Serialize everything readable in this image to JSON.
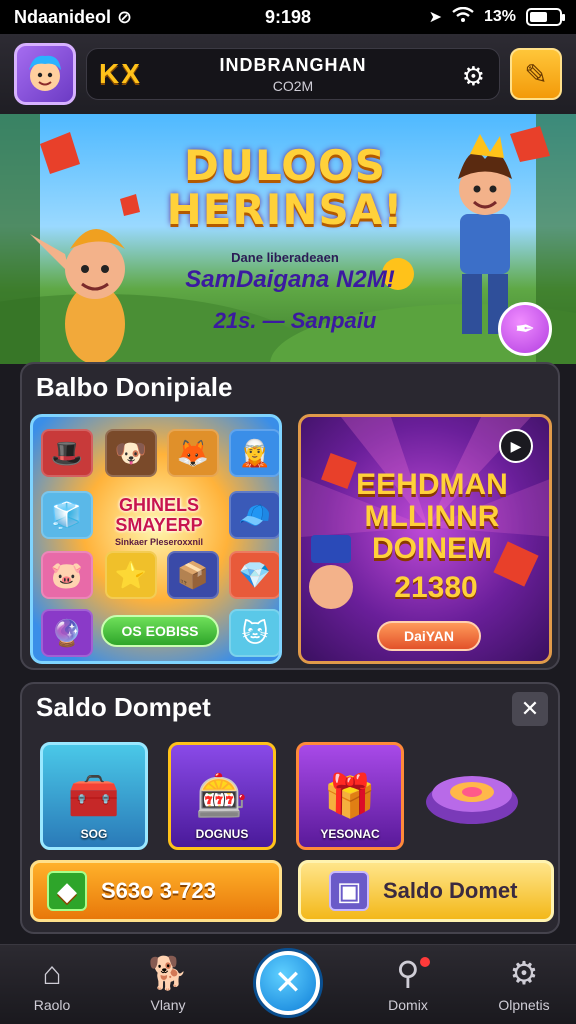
{
  "status_bar": {
    "carrier": "Ndaanideol",
    "time": "9:198",
    "battery": "13%",
    "battery_level": 0.6
  },
  "header": {
    "logo": "KX",
    "title": "INDBRANGHAN",
    "subtitle": "CO2M"
  },
  "banner": {
    "title_line1": "DULOOS",
    "title_line2": "HERINSA!",
    "small_text": "Dane liberadeaen",
    "line1": "SamDaigana N2M!",
    "line2": "21s. — Sanpaiu"
  },
  "section1": {
    "title": "Balbo Donipiale",
    "card1": {
      "label": "GHINELS SMAYERP",
      "sub_label": "Sinkaer Pleseroxxnil",
      "button": "OS EOBISS"
    },
    "card2": {
      "title": "EEHDMAN MLLINNR DOINEM",
      "value": "21380",
      "button": "DaiYAN"
    }
  },
  "section2": {
    "title": "Saldo Dompet",
    "items": [
      {
        "label": "SOG",
        "icon": "treasure-chest-icon"
      },
      {
        "label": "DOGNUS",
        "icon": "machine-icon"
      },
      {
        "label": "YESONAC",
        "icon": "gift-box-icon"
      },
      {
        "label": "",
        "icon": "hover-disc-icon"
      }
    ],
    "balance_button": "S63o 3-723",
    "wallet_button": "Saldo Domet"
  },
  "bottom_nav": [
    {
      "label": "Raolo",
      "icon": "home-icon"
    },
    {
      "label": "Vlany",
      "icon": "pet-icon"
    },
    {
      "label": "",
      "icon": "close-icon"
    },
    {
      "label": "Domix",
      "icon": "search-icon"
    },
    {
      "label": "Olpnetis",
      "icon": "gear-icon"
    }
  ],
  "colors": {
    "accent": "#ffc21a",
    "background": "#1b1a20",
    "panel": "#2a2830",
    "nav_center": "#0f7ed8"
  }
}
